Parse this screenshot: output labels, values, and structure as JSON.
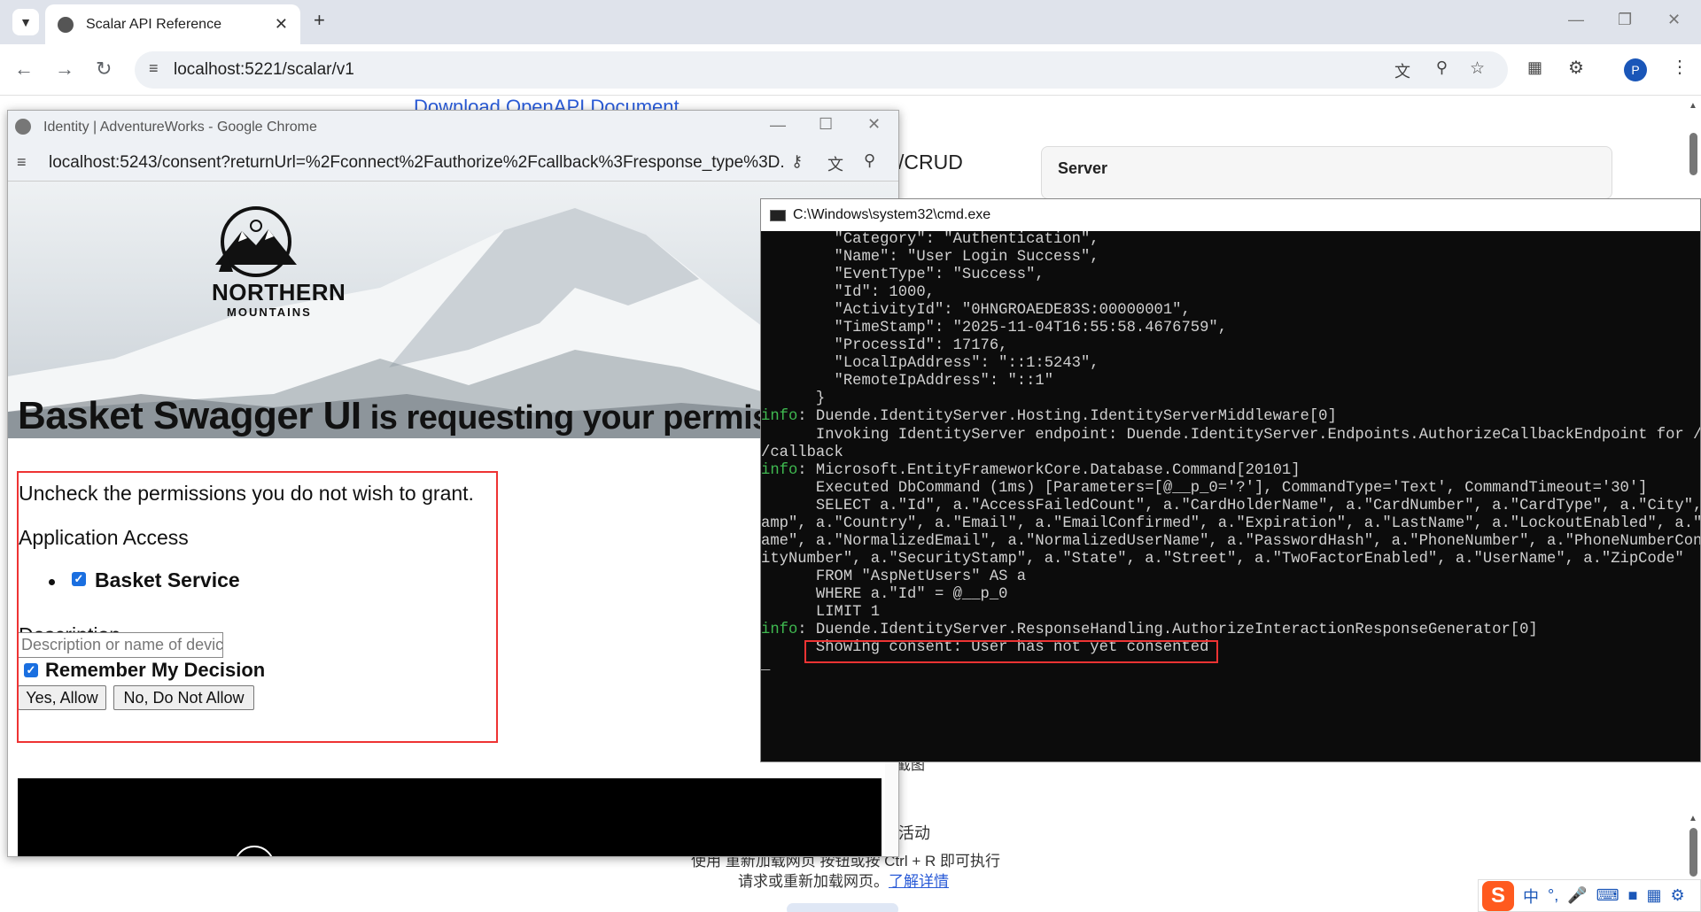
{
  "main_browser": {
    "tab_title": "Scalar API Reference",
    "url": "localhost:5221/scalar/v1",
    "avatar_letter": "P"
  },
  "scalar_page": {
    "download_link": "Download OpenAPI Document",
    "crud_text": "/CRUD",
    "server_label": "Server",
    "cn_line1": "截图",
    "cn_line2": "活动",
    "cn_line3": "使用 重新加载网页 按钮或按 Ctrl + R 即可执行",
    "cn_line4": "请求或重新加载网页。",
    "cn_link": "了解详情"
  },
  "ime_bar": {
    "logo": "S",
    "lang": "中",
    "punct": "°,"
  },
  "popup": {
    "window_title": "Identity | AdventureWorks - Google Chrome",
    "url": "localhost:5243/consent?returnUrl=%2Fconnect%2Fauthorize%2Fcallback%3Fresponse_type%3D...",
    "logo_line1": "NORTHERN",
    "logo_line2": "MOUNTAINS",
    "heading_app": "Basket Swagger UI",
    "heading_rest": " is requesting your permission",
    "instruction": "Uncheck the permissions you do not wish to grant.",
    "section_app_access": "Application Access",
    "scope_basket": "Basket Service",
    "section_description": "Description",
    "description_placeholder": "Description or name of device",
    "remember_label": "Remember My Decision",
    "yes_button": "Yes, Allow",
    "no_button": "No, Do Not Allow"
  },
  "cmd": {
    "title": "C:\\Windows\\system32\\cmd.exe",
    "lines": [
      {
        "pre": "",
        "text": "        \"Category\": \"Authentication\","
      },
      {
        "pre": "",
        "text": "        \"Name\": \"User Login Success\","
      },
      {
        "pre": "",
        "text": "        \"EventType\": \"Success\","
      },
      {
        "pre": "",
        "text": "        \"Id\": 1000,"
      },
      {
        "pre": "",
        "text": "        \"ActivityId\": \"0HNGROAEDE83S:00000001\","
      },
      {
        "pre": "",
        "text": "        \"TimeStamp\": \"2025-11-04T16:55:58.4676759\","
      },
      {
        "pre": "",
        "text": "        \"ProcessId\": 17176,"
      },
      {
        "pre": "",
        "text": "        \"LocalIpAddress\": \"::1:5243\","
      },
      {
        "pre": "",
        "text": "        \"RemoteIpAddress\": \"::1\""
      },
      {
        "pre": "",
        "text": "      }"
      },
      {
        "pre": "info",
        "text": ": Duende.IdentityServer.Hosting.IdentityServerMiddleware[0]"
      },
      {
        "pre": "",
        "text": "      Invoking IdentityServer endpoint: Duende.IdentityServer.Endpoints.AuthorizeCallbackEndpoint for /connect/authorize"
      },
      {
        "pre": "",
        "text": "/callback"
      },
      {
        "pre": "info",
        "text": ": Microsoft.EntityFrameworkCore.Database.Command[20101]"
      },
      {
        "pre": "",
        "text": "      Executed DbCommand (1ms) [Parameters=[@__p_0='?'], CommandType='Text', CommandTimeout='30']"
      },
      {
        "pre": "",
        "text": "      SELECT a.\"Id\", a.\"AccessFailedCount\", a.\"CardHolderName\", a.\"CardNumber\", a.\"CardType\", a.\"City\", a.\"ConcurrencyStamp\""
      },
      {
        "pre": "",
        "text": "amp\", a.\"Country\", a.\"Email\", a.\"EmailConfirmed\", a.\"Expiration\", a.\"LastName\", a.\"LockoutEnabled\", a.\"LockoutEnd\", a.\"N"
      },
      {
        "pre": "",
        "text": "ame\", a.\"NormalizedEmail\", a.\"NormalizedUserName\", a.\"PasswordHash\", a.\"PhoneNumber\", a.\"PhoneNumberConfirmed\", a.\"Secur"
      },
      {
        "pre": "",
        "text": "ityNumber\", a.\"SecurityStamp\", a.\"State\", a.\"Street\", a.\"TwoFactorEnabled\", a.\"UserName\", a.\"ZipCode\""
      },
      {
        "pre": "",
        "text": "      FROM \"AspNetUsers\" AS a"
      },
      {
        "pre": "",
        "text": "      WHERE a.\"Id\" = @__p_0"
      },
      {
        "pre": "",
        "text": "      LIMIT 1"
      },
      {
        "pre": "info",
        "text": ": Duende.IdentityServer.ResponseHandling.AuthorizeInteractionResponseGenerator[0]"
      },
      {
        "pre": "",
        "text": "      Showing consent: User has not yet consented"
      },
      {
        "pre": "",
        "text": ""
      },
      {
        "pre": "",
        "text": "_"
      }
    ]
  },
  "colors": {
    "highlight_border": "#e33333",
    "info_green": "#3fb950",
    "link_blue": "#2a5bd7"
  }
}
